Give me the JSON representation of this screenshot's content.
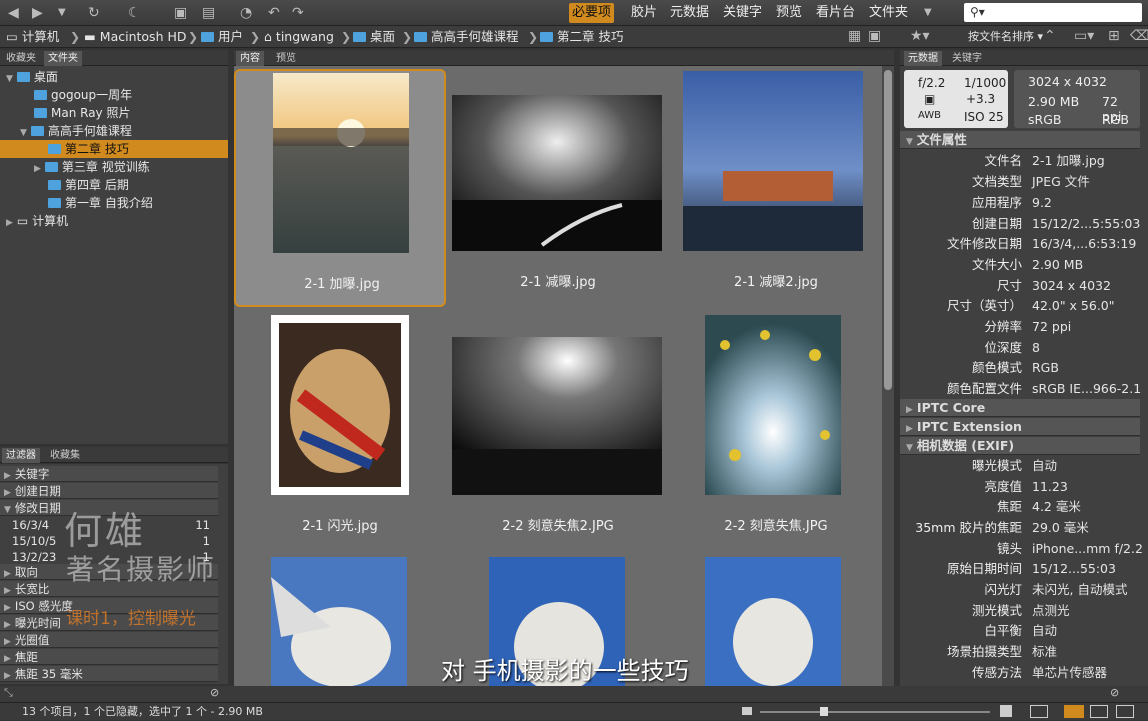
{
  "workspaces": [
    "必要项",
    "胶片",
    "元数据",
    "关键字",
    "预览",
    "看片台",
    "文件夹"
  ],
  "search_placeholder": "",
  "path": [
    "计算机",
    "Macintosh HD",
    "用户",
    "tingwang",
    "桌面",
    "高高手何雄课程",
    "第二章 技巧"
  ],
  "sort_label": "按文件名排序",
  "left_tabs": [
    "收藏夹",
    "文件夹"
  ],
  "content_tabs": [
    "内容",
    "预览"
  ],
  "right_tabs": [
    "元数据",
    "关键字"
  ],
  "filter_tabs": [
    "过滤器",
    "收藏集"
  ],
  "tree": [
    {
      "label": "桌面",
      "level": 0
    },
    {
      "label": "gogoup一周年",
      "level": 1
    },
    {
      "label": "Man Ray 照片",
      "level": 1
    },
    {
      "label": "高高手何雄课程",
      "level": 1
    },
    {
      "label": "第二章 技巧",
      "level": 2,
      "selected": true
    },
    {
      "label": "第三章 视觉训练",
      "level": 2
    },
    {
      "label": "第四章 后期",
      "level": 2
    },
    {
      "label": "第一章 自我介绍",
      "level": 2
    },
    {
      "label": "计算机",
      "level": 0
    }
  ],
  "filters": [
    "关键字",
    "创建日期",
    "修改日期",
    "取向",
    "长宽比",
    "ISO 感光度",
    "曝光时间",
    "光圈值",
    "焦距",
    "焦距 35 毫米"
  ],
  "modified_dates": [
    {
      "date": "16/3/4",
      "count": "11"
    },
    {
      "date": "15/10/5",
      "count": "1"
    },
    {
      "date": "13/2/23",
      "count": "1"
    }
  ],
  "watermark": {
    "name": "何雄",
    "title": "著名摄影师",
    "lesson": "课时1，控制曝光"
  },
  "files": [
    {
      "name": "2-1 加曝.jpg",
      "selected": true
    },
    {
      "name": "2-1 减曝.jpg"
    },
    {
      "name": "2-1 减曝2.jpg"
    },
    {
      "name": "2-1 闪光.jpg"
    },
    {
      "name": "2-2 刻意失焦2.JPG"
    },
    {
      "name": "2-2 刻意失焦.JPG"
    },
    {
      "name": ""
    },
    {
      "name": ""
    },
    {
      "name": ""
    }
  ],
  "camera": {
    "aperture": "f/2.2",
    "shutter": "1/1000",
    "ev": "+3.3",
    "iso": "ISO 25",
    "awb": "AWB",
    "dims": "3024 x 4032",
    "size": "2.90 MB",
    "ppi": "72 ppi",
    "profile": "sRGB",
    "mode": "RGB"
  },
  "file_props_title": "文件属性",
  "file_props": [
    {
      "k": "文件名",
      "v": "2-1 加曝.jpg"
    },
    {
      "k": "文档类型",
      "v": "JPEG 文件"
    },
    {
      "k": "应用程序",
      "v": "9.2"
    },
    {
      "k": "创建日期",
      "v": "15/12/2...5:55:03"
    },
    {
      "k": "文件修改日期",
      "v": "16/3/4,...6:53:19"
    },
    {
      "k": "文件大小",
      "v": "2.90 MB"
    },
    {
      "k": "尺寸",
      "v": "3024 x 4032"
    },
    {
      "k": "尺寸（英寸）",
      "v": "42.0\" x 56.0\""
    },
    {
      "k": "分辨率",
      "v": "72 ppi"
    },
    {
      "k": "位深度",
      "v": "8"
    },
    {
      "k": "颜色模式",
      "v": "RGB"
    },
    {
      "k": "颜色配置文件",
      "v": "sRGB IE...966-2.1"
    }
  ],
  "sections": [
    "IPTC Core",
    "IPTC Extension",
    "相机数据 (EXIF)"
  ],
  "exif": [
    {
      "k": "曝光模式",
      "v": "自动"
    },
    {
      "k": "亮度值",
      "v": "11.23"
    },
    {
      "k": "焦距",
      "v": "4.2 毫米"
    },
    {
      "k": "35mm 胶片的焦距",
      "v": "29.0 毫米"
    },
    {
      "k": "镜头",
      "v": "iPhone...mm f/2.2"
    },
    {
      "k": "原始日期时间",
      "v": "15/12...55:03"
    },
    {
      "k": "闪光灯",
      "v": "未闪光, 自动模式"
    },
    {
      "k": "测光模式",
      "v": "点测光"
    },
    {
      "k": "白平衡",
      "v": "自动"
    },
    {
      "k": "场景拍摄类型",
      "v": "标准"
    },
    {
      "k": "传感方法",
      "v": "单芯片传感器"
    }
  ],
  "statusbar": "13 个项目，1 个已隐藏，选中了 1 个 - 2.90 MB",
  "subtitle": "对 手机摄影的一些技巧"
}
